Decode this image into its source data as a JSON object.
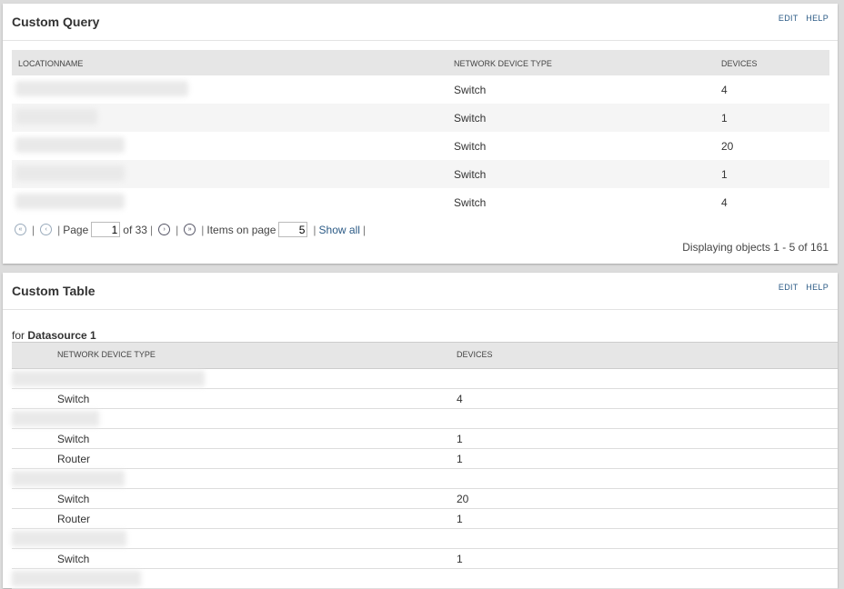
{
  "custom_query": {
    "title": "Custom Query",
    "edit_label": "EDIT",
    "help_label": "HELP",
    "columns": [
      "LOCATIONNAME",
      "NETWORK DEVICE TYPE",
      "DEVICES"
    ],
    "rows": [
      {
        "type": "Switch",
        "devices": "4"
      },
      {
        "type": "Switch",
        "devices": "1"
      },
      {
        "type": "Switch",
        "devices": "20"
      },
      {
        "type": "Switch",
        "devices": "1"
      },
      {
        "type": "Switch",
        "devices": "4"
      }
    ],
    "pager": {
      "page_label": "Page",
      "page_value": "1",
      "of_label": "of 33",
      "items_label": "Items on page",
      "items_value": "5",
      "show_all": "Show all"
    },
    "display_info": "Displaying objects 1 - 5 of 161"
  },
  "custom_table": {
    "title": "Custom Table",
    "edit_label": "EDIT",
    "help_label": "HELP",
    "for_label": "for",
    "datasource": "Datasource 1",
    "columns": [
      "NETWORK DEVICE TYPE",
      "DEVICES"
    ],
    "rows": [
      {
        "type": "Switch",
        "devices": "4"
      },
      {
        "type": "Switch",
        "devices": "1"
      },
      {
        "type": "Router",
        "devices": "1"
      },
      {
        "type": "Switch",
        "devices": "20"
      },
      {
        "type": "Router",
        "devices": "1"
      },
      {
        "type": "Switch",
        "devices": "1"
      }
    ]
  },
  "colors": {
    "link": "#2c5b86",
    "header_bg": "#e6e6e6",
    "stripe_bg": "#f5f5f5"
  },
  "icons": {
    "first": "first-page-icon",
    "prev": "prev-page-icon",
    "next": "next-page-icon",
    "last": "last-page-icon"
  }
}
